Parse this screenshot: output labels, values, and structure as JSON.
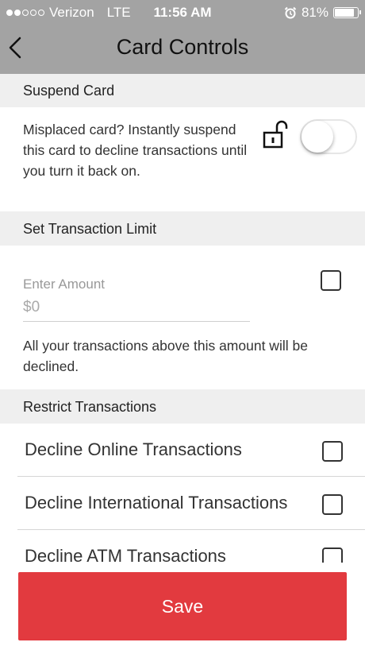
{
  "status_bar": {
    "carrier": "Verizon",
    "network": "LTE",
    "time": "11:56 AM",
    "battery": "81%",
    "battery_level": 0.81,
    "signal_bars_filled": 2,
    "signal_bars_total": 5
  },
  "nav": {
    "title": "Card Controls",
    "back_icon": "chevron-left-icon"
  },
  "suspend": {
    "header": "Suspend Card",
    "description": "Misplaced card? Instantly suspend this card to decline transactions until you turn it back on.",
    "lock_icon": "unlocked-padlock-icon",
    "toggle_on": false
  },
  "limit": {
    "header": "Set Transaction Limit",
    "field_label": "Enter Amount",
    "placeholder": "$0",
    "value": "",
    "checked": false,
    "note": "All your transactions above this amount will be declined."
  },
  "restrict": {
    "header": "Restrict Transactions",
    "items": [
      {
        "label": "Decline Online Transactions",
        "checked": false
      },
      {
        "label": "Decline International Transactions",
        "checked": false
      },
      {
        "label": "Decline ATM Transactions",
        "checked": false
      }
    ]
  },
  "save_label": "Save",
  "colors": {
    "topbar": "#a3a3a3",
    "section_bg": "#efefef",
    "save_button": "#e23a3f"
  }
}
